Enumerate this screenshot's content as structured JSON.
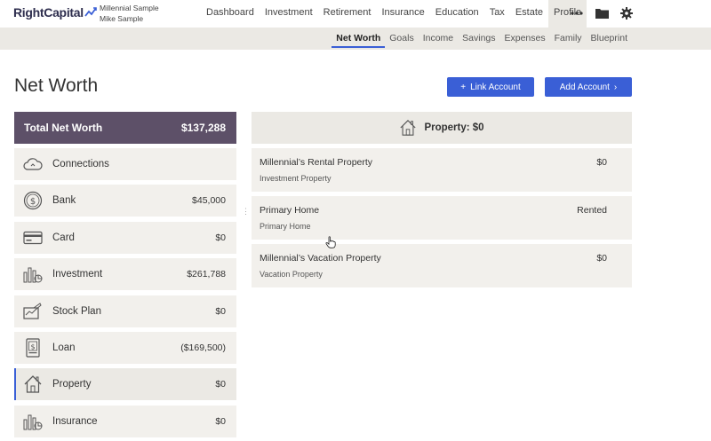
{
  "app": {
    "logo_text": "RightCapital",
    "client_primary": "Millennial Sample",
    "client_secondary": "Mike Sample"
  },
  "nav": {
    "items": [
      {
        "label": "Dashboard"
      },
      {
        "label": "Investment"
      },
      {
        "label": "Retirement"
      },
      {
        "label": "Insurance"
      },
      {
        "label": "Education"
      },
      {
        "label": "Tax"
      },
      {
        "label": "Estate"
      },
      {
        "label": "Profile"
      }
    ],
    "active": "Profile",
    "more_icon": "more-dots-icon",
    "folder_icon": "folder-icon",
    "settings_icon": "gear-icon"
  },
  "subnav": {
    "items": [
      {
        "label": "Net Worth"
      },
      {
        "label": "Goals"
      },
      {
        "label": "Income"
      },
      {
        "label": "Savings"
      },
      {
        "label": "Expenses"
      },
      {
        "label": "Family"
      },
      {
        "label": "Blueprint"
      }
    ],
    "active": "Net Worth"
  },
  "page": {
    "title": "Net Worth",
    "link_button": "Link Account",
    "add_button": "Add Account"
  },
  "summary": {
    "label": "Total Net Worth",
    "value": "$137,288"
  },
  "accounts": [
    {
      "label": "Connections",
      "value": "",
      "icon": "cloud-icon"
    },
    {
      "label": "Bank",
      "value": "$45,000",
      "icon": "dollar-coin-icon"
    },
    {
      "label": "Card",
      "value": "$0",
      "icon": "credit-card-icon"
    },
    {
      "label": "Investment",
      "value": "$261,788",
      "icon": "bar-chart-icon"
    },
    {
      "label": "Stock Plan",
      "value": "$0",
      "icon": "stock-check-icon"
    },
    {
      "label": "Loan",
      "value": "($169,500)",
      "icon": "loan-document-icon"
    },
    {
      "label": "Property",
      "value": "$0",
      "icon": "house-icon"
    },
    {
      "label": "Insurance",
      "value": "$0",
      "icon": "insurance-chart-icon"
    }
  ],
  "active_account": "Property",
  "property_panel": {
    "header": "Property: $0",
    "items": [
      {
        "name": "Millennial’s Rental Property",
        "type": "Investment Property",
        "value": "$0"
      },
      {
        "name": "Primary Home",
        "type": "Primary Home",
        "value": "Rented"
      },
      {
        "name": "Millennial’s Vacation Property",
        "type": "Vacation Property",
        "value": "$0"
      }
    ]
  },
  "colors": {
    "accent": "#3a5fd6",
    "summary_bg": "#5d5068",
    "panel_bg": "#f2f0ec",
    "subnav_bg": "#ebe9e4"
  }
}
